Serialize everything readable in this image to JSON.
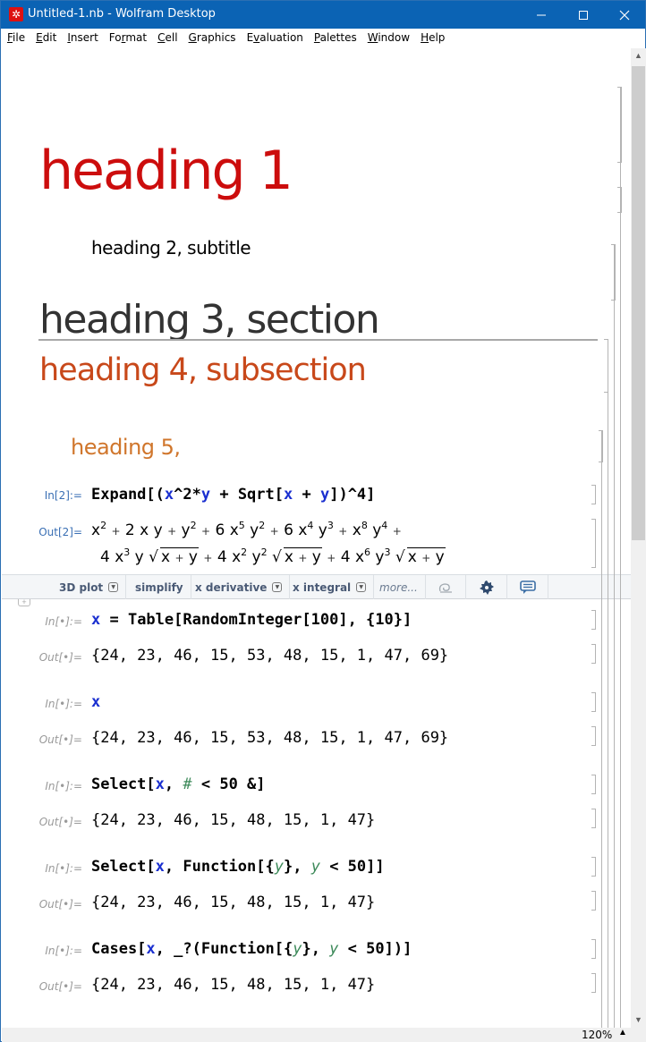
{
  "window": {
    "title": "Untitled-1.nb - Wolfram Desktop",
    "app_icon": "wolfram-icon",
    "controls": {
      "minimize": "—",
      "maximize": "☐",
      "close": "✕"
    }
  },
  "menubar": {
    "items": [
      {
        "label": "File",
        "accel": "F",
        "rest": "ile"
      },
      {
        "label": "Edit",
        "accel": "E",
        "rest": "dit"
      },
      {
        "label": "Insert",
        "accel": "I",
        "rest": "nsert"
      },
      {
        "label": "Format",
        "pre": "Fo",
        "accel": "r",
        "rest": "mat"
      },
      {
        "label": "Cell",
        "accel": "C",
        "rest": "ell"
      },
      {
        "label": "Graphics",
        "accel": "G",
        "rest": "raphics"
      },
      {
        "label": "Evaluation",
        "pre": "E",
        "accel": "v",
        "rest": "aluation"
      },
      {
        "label": "Palettes",
        "accel": "P",
        "rest": "alettes"
      },
      {
        "label": "Window",
        "accel": "W",
        "rest": "indow"
      },
      {
        "label": "Help",
        "accel": "H",
        "rest": "elp"
      }
    ]
  },
  "notebook": {
    "headings": {
      "title": "heading 1",
      "subtitle": "heading 2, subtitle",
      "section": "heading 3, section",
      "subsection": "heading 4, subsection",
      "subsubsection": "heading 5,"
    },
    "colors": {
      "title": "#cc0d0d",
      "subsection": "#c8481a",
      "subsubsection": "#d0762c",
      "symbol": "#1a2fd0",
      "local_var": "#3d8a5a",
      "label_numbered": "#3a6fb4",
      "label_unnumbered": "#9a9a9a"
    },
    "cells": [
      {
        "in_label": "In[2]:=",
        "input": "Expand[(x^2*y + Sqrt[x + y])^4]",
        "out_label": "Out[2]=",
        "output_line1": "x² + 2 x y + y² + 6 x⁵ y² + 6 x⁴ y³ + x⁸ y⁴ +",
        "output_line2": "4 x³ y √(x + y) + 4 x² y² √(x + y) + 4 x⁶ y³ √(x + y)"
      },
      {
        "in_label": "In[•]:=",
        "input": "x = Table[RandomInteger[100], {10}]",
        "out_label": "Out[•]=",
        "output": "{24, 23, 46, 15, 53, 48, 15, 1, 47, 69}"
      },
      {
        "in_label": "In[•]:=",
        "input": "x",
        "out_label": "Out[•]=",
        "output": "{24, 23, 46, 15, 53, 48, 15, 1, 47, 69}"
      },
      {
        "in_label": "In[•]:=",
        "input": "Select[x, # < 50 &]",
        "out_label": "Out[•]=",
        "output": "{24, 23, 46, 15, 48, 15, 1, 47}"
      },
      {
        "in_label": "In[•]:=",
        "input": "Select[x, Function[{y}, y < 50]]",
        "out_label": "Out[•]=",
        "output": "{24, 23, 46, 15, 48, 15, 1, 47}"
      },
      {
        "in_label": "In[•]:=",
        "input": "Cases[x, _?(Function[{y}, y < 50])]",
        "out_label": "Out[•]=",
        "output": "{24, 23, 46, 15, 48, 15, 1, 47}"
      }
    ]
  },
  "suggestions_bar": {
    "items": [
      {
        "label": "3D plot",
        "has_menu": true
      },
      {
        "label": "simplify",
        "has_menu": false
      },
      {
        "label": "x derivative",
        "has_menu": true
      },
      {
        "label": "x integral",
        "has_menu": true
      },
      {
        "label": "more...",
        "has_menu": false
      }
    ],
    "icons": [
      "undo-spiral-icon",
      "settings-gear-icon",
      "feedback-chat-icon"
    ]
  },
  "status": {
    "zoom": "120%"
  }
}
